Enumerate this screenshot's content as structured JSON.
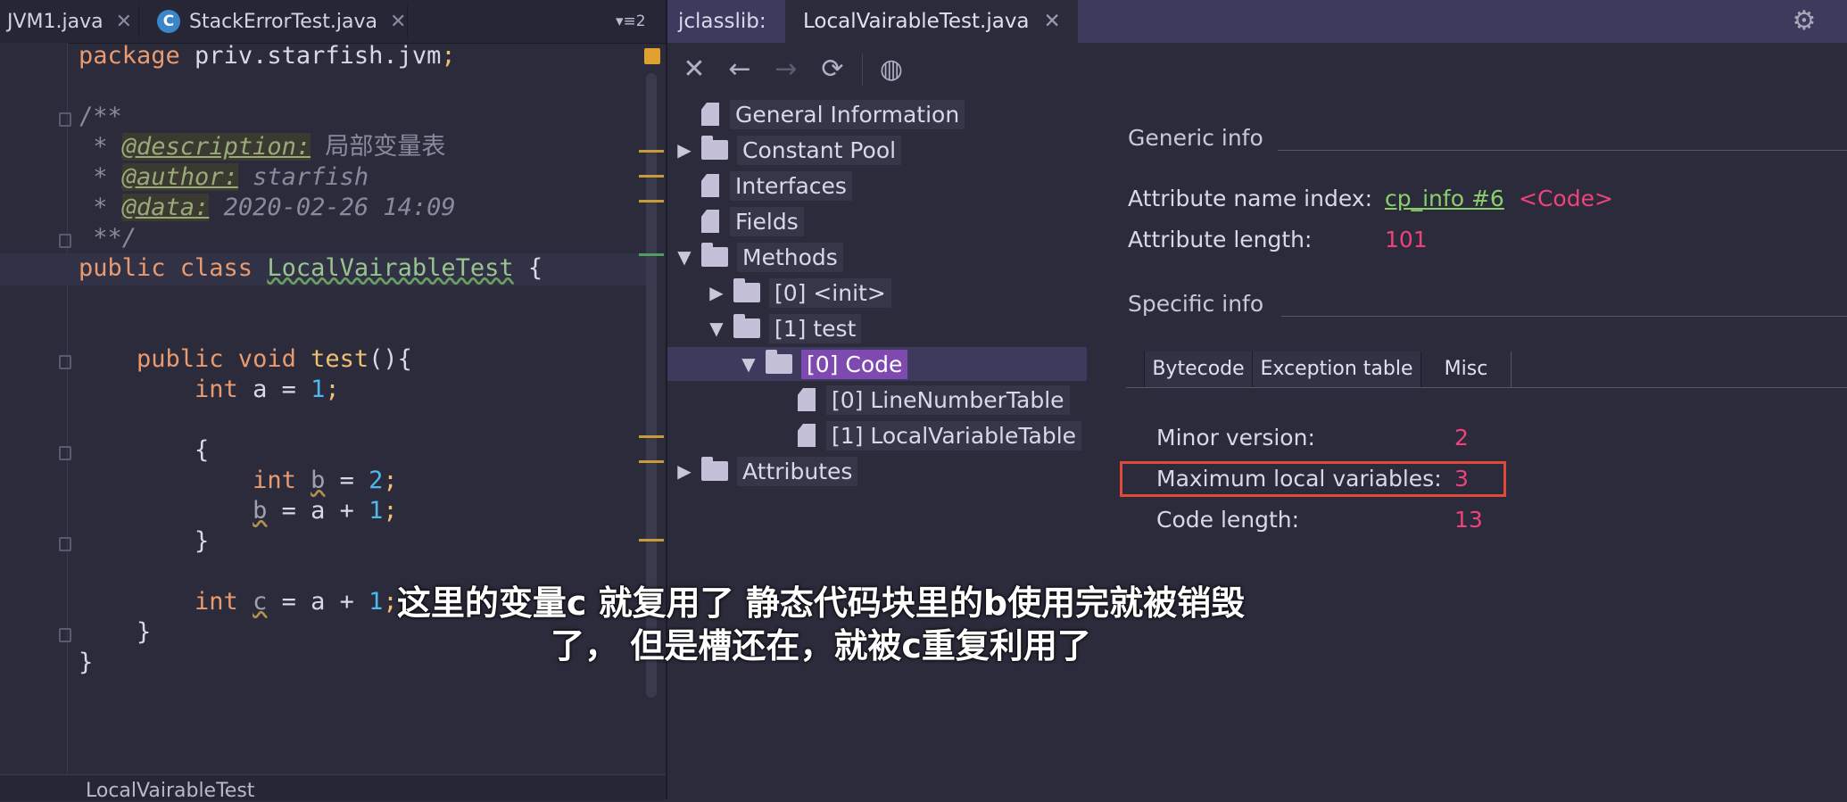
{
  "editor": {
    "tabs": [
      {
        "label": "JVM1.java",
        "close": "✕"
      },
      {
        "label": "StackErrorTest.java",
        "icon": "C",
        "close": "✕"
      }
    ],
    "tab_menu": "▾≡2",
    "code_lines": {
      "l1_kw": "package",
      "l1_rest": " priv.starfish.jvm",
      "l1_semi": ";",
      "l3": "/**",
      "l4_star": " * ",
      "l4_tag": "@description:",
      "l4_val": " 局部变量表",
      "l5_star": " * ",
      "l5_tag": "@author:",
      "l5_val": " starfish",
      "l6_star": " * ",
      "l6_tag": "@data:",
      "l6_val": " 2020-02-26 14:09",
      "l7": " **/",
      "l8_kw": "public class ",
      "l8_cls": "LocalVairableTest",
      "l8_rest": " {",
      "l11_kw": "    public void ",
      "l11_fn": "test",
      "l11_rest": "(){",
      "l12_kw": "        int",
      "l12_rest": " a = ",
      "l12_num": "1",
      "l12_semi": ";",
      "l14": "        {",
      "l15_kw": "            int ",
      "l15_var": "b",
      "l15_rest": " = ",
      "l15_num": "2",
      "l15_semi": ";",
      "l16_pre": "            ",
      "l16_var": "b",
      "l16_rest": " = a + ",
      "l16_num": "1",
      "l16_semi": ";",
      "l17": "        }",
      "l19_kw": "        int ",
      "l19_var": "c",
      "l19_rest": " = a + ",
      "l19_num": "1",
      "l19_semi": ";",
      "l20": "    }",
      "l21": "}"
    },
    "breadcrumb": "LocalVairableTest"
  },
  "jclasslib": {
    "label": "jclasslib:",
    "tab": "LocalVairableTest.java",
    "tab_close": "✕",
    "tree": {
      "general": "General Information",
      "constant_pool": "Constant Pool",
      "interfaces": "Interfaces",
      "fields": "Fields",
      "methods": "Methods",
      "init": "[0] <init>",
      "test": "[1] test",
      "code": "[0] Code",
      "lnt": "[0] LineNumberTable",
      "lvt": "[1] LocalVariableTable",
      "attributes": "Attributes"
    },
    "generic_info": "Generic info",
    "attr_name_index_label": "Attribute name index:",
    "attr_name_index_link": "cp_info #6",
    "attr_name_index_value": "<Code>",
    "attr_length_label": "Attribute length:",
    "attr_length_value": "101",
    "specific_info": "Specific info",
    "subtabs": [
      "Bytecode",
      "Exception table",
      "Misc"
    ],
    "minor_version_label": "Minor version:",
    "minor_version_value": "2",
    "max_locals_label": "Maximum local variables:",
    "max_locals_value": "3",
    "code_length_label": "Code length:",
    "code_length_value": "13"
  },
  "subtitle": {
    "line1": "这里的变量c 就复用了 静态代码块里的b使用完就被销毁",
    "line2": "了， 但是槽还在，就被c重复利用了"
  },
  "colors": {
    "accent_purple": "#7e4ab0",
    "value_red": "#f0427a",
    "link_green": "#8bcf6a",
    "highlight_box": "#e04a3a"
  }
}
